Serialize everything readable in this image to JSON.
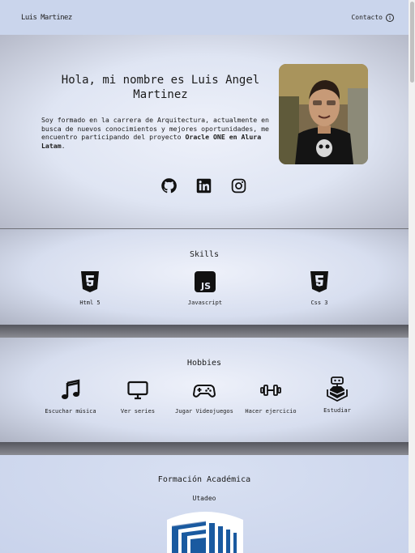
{
  "header": {
    "logo": "Luis Martinez",
    "contact_label": "Contacto"
  },
  "hero": {
    "title": "Hola, mi nombre es Luis Angel Martinez",
    "intro": "Soy formado en la carrera de Arquitectura, actualmente en busca de nuevos conocimientos y mejores oportunidades, me encuentro participando del proyecto ",
    "highlight": "Oracle ONE en Alura Latam",
    "end": "."
  },
  "socials": [
    {
      "icon": "github-icon"
    },
    {
      "icon": "linkedin-icon"
    },
    {
      "icon": "instagram-icon"
    }
  ],
  "skills": {
    "title": "Skills",
    "items": [
      {
        "label": "Html 5",
        "icon": "html5-icon"
      },
      {
        "label": "Javascript",
        "icon": "javascript-icon"
      },
      {
        "label": "Css 3",
        "icon": "css3-icon"
      }
    ]
  },
  "hobbies": {
    "title": "Hobbies",
    "items": [
      {
        "label": "Escuchar música",
        "icon": "music-note-icon"
      },
      {
        "label": "Ver series",
        "icon": "monitor-icon"
      },
      {
        "label": "Jugar Videojuegos",
        "icon": "gamepad-icon"
      },
      {
        "label": "Hacer ejercicio",
        "icon": "dumbbell-icon"
      },
      {
        "label": "Estudiar",
        "icon": "study-robot-icon"
      }
    ]
  },
  "education": {
    "title": "Formación Académica",
    "institution": "Utadeo"
  },
  "colors": {
    "header_bg": "#cad5ec",
    "accent_blue": "#1a5aa0"
  }
}
